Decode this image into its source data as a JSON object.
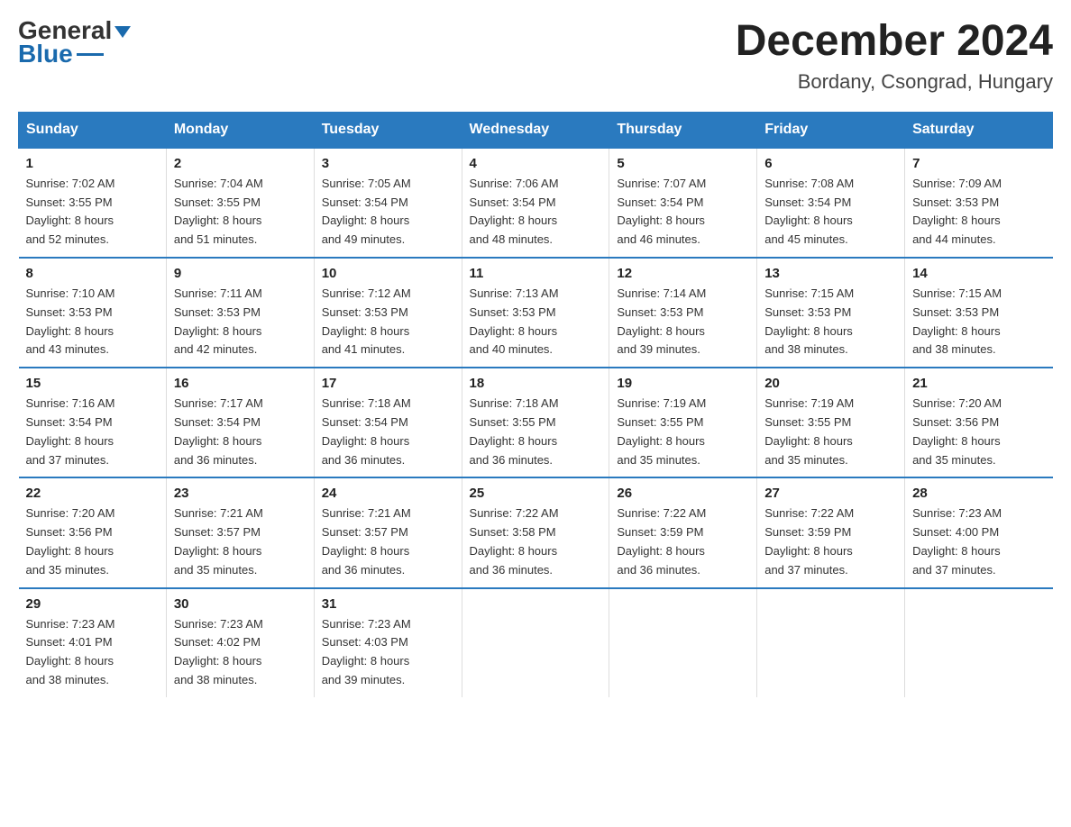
{
  "header": {
    "logo_general": "General",
    "logo_blue": "Blue",
    "month_title": "December 2024",
    "location": "Bordany, Csongrad, Hungary"
  },
  "days_of_week": [
    "Sunday",
    "Monday",
    "Tuesday",
    "Wednesday",
    "Thursday",
    "Friday",
    "Saturday"
  ],
  "weeks": [
    [
      {
        "day": "1",
        "sunrise": "7:02 AM",
        "sunset": "3:55 PM",
        "daylight": "8 hours and 52 minutes."
      },
      {
        "day": "2",
        "sunrise": "7:04 AM",
        "sunset": "3:55 PM",
        "daylight": "8 hours and 51 minutes."
      },
      {
        "day": "3",
        "sunrise": "7:05 AM",
        "sunset": "3:54 PM",
        "daylight": "8 hours and 49 minutes."
      },
      {
        "day": "4",
        "sunrise": "7:06 AM",
        "sunset": "3:54 PM",
        "daylight": "8 hours and 48 minutes."
      },
      {
        "day": "5",
        "sunrise": "7:07 AM",
        "sunset": "3:54 PM",
        "daylight": "8 hours and 46 minutes."
      },
      {
        "day": "6",
        "sunrise": "7:08 AM",
        "sunset": "3:54 PM",
        "daylight": "8 hours and 45 minutes."
      },
      {
        "day": "7",
        "sunrise": "7:09 AM",
        "sunset": "3:53 PM",
        "daylight": "8 hours and 44 minutes."
      }
    ],
    [
      {
        "day": "8",
        "sunrise": "7:10 AM",
        "sunset": "3:53 PM",
        "daylight": "8 hours and 43 minutes."
      },
      {
        "day": "9",
        "sunrise": "7:11 AM",
        "sunset": "3:53 PM",
        "daylight": "8 hours and 42 minutes."
      },
      {
        "day": "10",
        "sunrise": "7:12 AM",
        "sunset": "3:53 PM",
        "daylight": "8 hours and 41 minutes."
      },
      {
        "day": "11",
        "sunrise": "7:13 AM",
        "sunset": "3:53 PM",
        "daylight": "8 hours and 40 minutes."
      },
      {
        "day": "12",
        "sunrise": "7:14 AM",
        "sunset": "3:53 PM",
        "daylight": "8 hours and 39 minutes."
      },
      {
        "day": "13",
        "sunrise": "7:15 AM",
        "sunset": "3:53 PM",
        "daylight": "8 hours and 38 minutes."
      },
      {
        "day": "14",
        "sunrise": "7:15 AM",
        "sunset": "3:53 PM",
        "daylight": "8 hours and 38 minutes."
      }
    ],
    [
      {
        "day": "15",
        "sunrise": "7:16 AM",
        "sunset": "3:54 PM",
        "daylight": "8 hours and 37 minutes."
      },
      {
        "day": "16",
        "sunrise": "7:17 AM",
        "sunset": "3:54 PM",
        "daylight": "8 hours and 36 minutes."
      },
      {
        "day": "17",
        "sunrise": "7:18 AM",
        "sunset": "3:54 PM",
        "daylight": "8 hours and 36 minutes."
      },
      {
        "day": "18",
        "sunrise": "7:18 AM",
        "sunset": "3:55 PM",
        "daylight": "8 hours and 36 minutes."
      },
      {
        "day": "19",
        "sunrise": "7:19 AM",
        "sunset": "3:55 PM",
        "daylight": "8 hours and 35 minutes."
      },
      {
        "day": "20",
        "sunrise": "7:19 AM",
        "sunset": "3:55 PM",
        "daylight": "8 hours and 35 minutes."
      },
      {
        "day": "21",
        "sunrise": "7:20 AM",
        "sunset": "3:56 PM",
        "daylight": "8 hours and 35 minutes."
      }
    ],
    [
      {
        "day": "22",
        "sunrise": "7:20 AM",
        "sunset": "3:56 PM",
        "daylight": "8 hours and 35 minutes."
      },
      {
        "day": "23",
        "sunrise": "7:21 AM",
        "sunset": "3:57 PM",
        "daylight": "8 hours and 35 minutes."
      },
      {
        "day": "24",
        "sunrise": "7:21 AM",
        "sunset": "3:57 PM",
        "daylight": "8 hours and 36 minutes."
      },
      {
        "day": "25",
        "sunrise": "7:22 AM",
        "sunset": "3:58 PM",
        "daylight": "8 hours and 36 minutes."
      },
      {
        "day": "26",
        "sunrise": "7:22 AM",
        "sunset": "3:59 PM",
        "daylight": "8 hours and 36 minutes."
      },
      {
        "day": "27",
        "sunrise": "7:22 AM",
        "sunset": "3:59 PM",
        "daylight": "8 hours and 37 minutes."
      },
      {
        "day": "28",
        "sunrise": "7:23 AM",
        "sunset": "4:00 PM",
        "daylight": "8 hours and 37 minutes."
      }
    ],
    [
      {
        "day": "29",
        "sunrise": "7:23 AM",
        "sunset": "4:01 PM",
        "daylight": "8 hours and 38 minutes."
      },
      {
        "day": "30",
        "sunrise": "7:23 AM",
        "sunset": "4:02 PM",
        "daylight": "8 hours and 38 minutes."
      },
      {
        "day": "31",
        "sunrise": "7:23 AM",
        "sunset": "4:03 PM",
        "daylight": "8 hours and 39 minutes."
      },
      null,
      null,
      null,
      null
    ]
  ],
  "labels": {
    "sunrise": "Sunrise:",
    "sunset": "Sunset:",
    "daylight": "Daylight:"
  }
}
